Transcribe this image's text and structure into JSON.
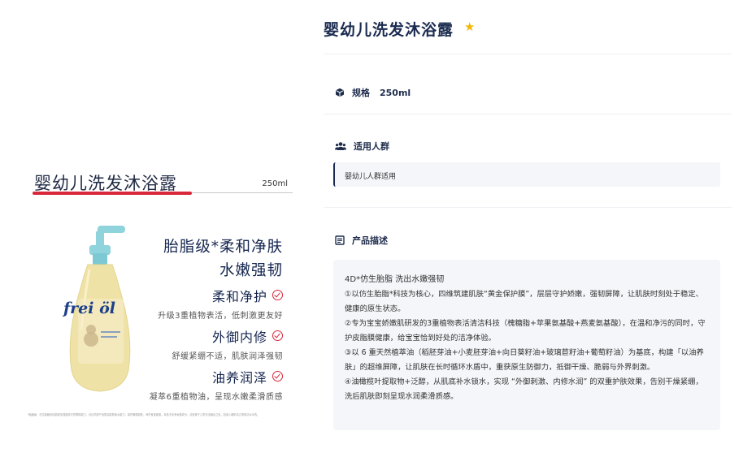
{
  "product_image": {
    "title": "婴幼儿洗发沐浴露",
    "size": "250ml",
    "brand_logo": "frei öl",
    "headline_line1": "胎脂级*柔和净肤",
    "headline_line2": "水嫩强韧",
    "features": [
      {
        "title": "柔和净护",
        "desc": "升级3重植物表活，低刺激更友好"
      },
      {
        "title": "外御内修",
        "desc": "舒缓紧绷不适，肌肤润泽强韧"
      },
      {
        "title": "油养润泽",
        "desc": "凝萃6重植物油，呈现水嫩柔滑质感"
      }
    ],
    "footnote": "*胎脂级：仿生胎脂科技能够加强肌肤天然屏障能力，对比同类产品提高肌肤锁水能力，保护脆弱肌肤，呵护宝宝健康。本品不含有皂基成分，请放置于儿童无法触及之处，如误入眼睛请立即用清水冲洗。"
  },
  "detail": {
    "title": "婴幼儿洗发沐浴露",
    "star_icon": "star-icon",
    "spec_label": "规格",
    "spec_value": "250ml",
    "audience_label": "适用人群",
    "audience_value": "婴幼儿人群适用",
    "desc_label": "产品描述",
    "desc_lines": [
      "4D*仿生胎脂  洗出水嫩强韧",
      "①以仿生胎脂*科技为核心，四维筑建肌肤“黄金保护膜”，层层守护娇嫩，强韧屏障，让肌肤时刻处于稳定、健康的原生状态。",
      "②专为宝宝娇嫩肌研发的3重植物表活清洁科技（槐糖脂+苹果氨基酸+燕麦氨基酸），在温和净污的同时，守护皮脂膜健康，给宝宝恰到好处的洁净体验。",
      "③以 6 重天然植萃油（稻胚芽油+小麦胚芽油+向日葵籽油+玻璃苣籽油+葡萄籽油）为基底，构建「以油养肤」的超维屏障，让肌肤在长时循环水盾中，重获原生防御力，抵御干燥、脆弱与外界刺激。",
      "④油橄榄叶提取物+泛醇，从肌底补水锁水，实现 “外御刺激、内修水润” 的双重护肤效果，告别干燥紧绷，洗后肌肤即刻呈现水润柔滑质感。"
    ]
  },
  "colors": {
    "accent_red": "#d8263a",
    "navy": "#1b2b50",
    "star": "#f2b705",
    "panel_bg": "#f4f6f9"
  }
}
